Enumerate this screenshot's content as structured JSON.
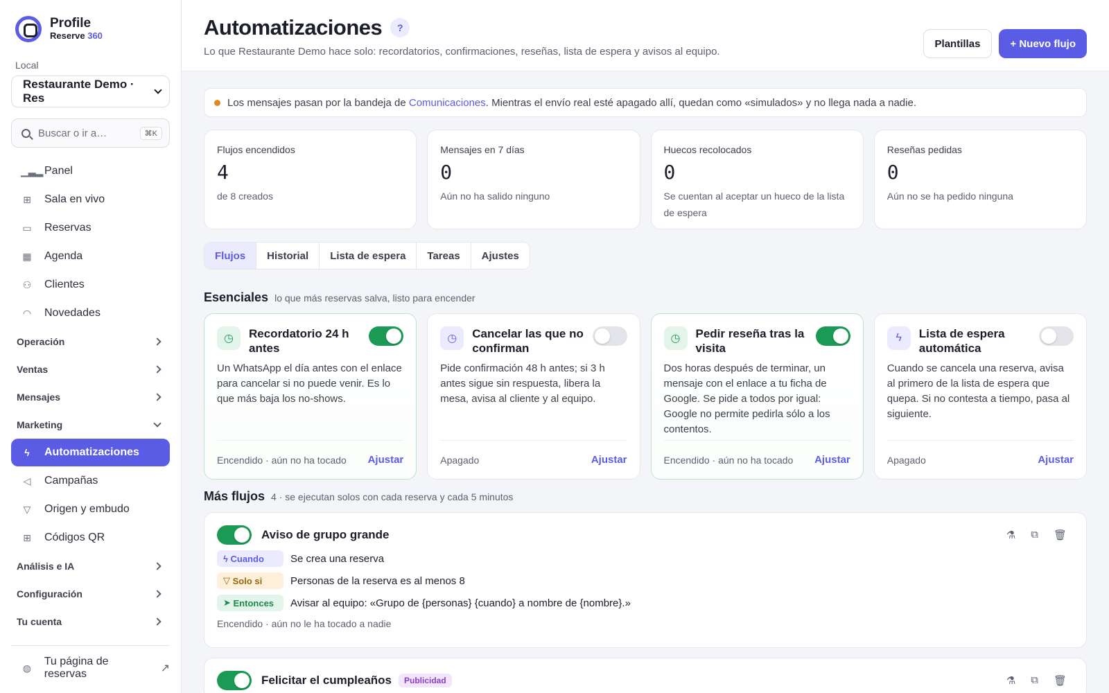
{
  "brand": {
    "name": "Profile",
    "sub_main": "Reserve ",
    "sub_num": "360"
  },
  "sidebar": {
    "local_label": "Local",
    "local_value": "Restaurante Demo · Res",
    "search_placeholder": "Buscar o ir a…",
    "search_kbd": "⌘K",
    "items": [
      {
        "label": "Panel",
        "icon": "chart-icon"
      },
      {
        "label": "Sala en vivo",
        "icon": "grid-icon"
      },
      {
        "label": "Reservas",
        "icon": "calendar-icon"
      },
      {
        "label": "Agenda",
        "icon": "table-icon"
      },
      {
        "label": "Clientes",
        "icon": "users-icon"
      },
      {
        "label": "Novedades",
        "icon": "bell-icon"
      }
    ],
    "groups": {
      "operacion": "Operación",
      "ventas": "Ventas",
      "mensajes": "Mensajes",
      "marketing": "Marketing",
      "analisis": "Análisis e IA",
      "configuracion": "Configuración",
      "cuenta": "Tu cuenta"
    },
    "marketing_items": [
      {
        "label": "Automatizaciones",
        "active": true
      },
      {
        "label": "Campañas"
      },
      {
        "label": "Origen y embudo"
      },
      {
        "label": "Códigos QR"
      }
    ],
    "booking_page": "Tu página de reservas"
  },
  "header": {
    "title": "Automatizaciones",
    "help": "?",
    "subtitle": "Lo que Restaurante Demo hace solo: recordatorios, confirmaciones, reseñas, lista de espera y avisos al equipo.",
    "templates_button": "Plantillas",
    "new_flow_button": "+ Nuevo flujo"
  },
  "notice": {
    "before": "Los mensajes pasan por la bandeja de ",
    "link": "Comunicaciones",
    "after": ". Mientras el envío real esté apagado allí, quedan como «simulados» y no llega nada a nadie."
  },
  "stats": [
    {
      "label": "Flujos encendidos",
      "value": "4",
      "note": "de 8 creados"
    },
    {
      "label": "Mensajes en 7 días",
      "value": "0",
      "note": "Aún no ha salido ninguno"
    },
    {
      "label": "Huecos recolocados",
      "value": "0",
      "note": "Se cuentan al aceptar un hueco de la lista de espera"
    },
    {
      "label": "Reseñas pedidas",
      "value": "0",
      "note": "Aún no se ha pedido ninguna"
    }
  ],
  "tabs": [
    "Flujos",
    "Historial",
    "Lista de espera",
    "Tareas",
    "Ajustes"
  ],
  "essentials": {
    "title": "Esenciales",
    "subtitle": "lo que más reservas salva, listo para encender",
    "adjust_label": "Ajustar",
    "cards": [
      {
        "title": "Recordatorio 24 h antes",
        "on": true,
        "desc": "Un WhatsApp el día antes con el enlace para cancelar si no puede venir. Es lo que más baja los no-shows.",
        "status": "Encendido · aún no ha tocado"
      },
      {
        "title": "Cancelar las que no confirman",
        "on": false,
        "desc": "Pide confirmación 48 h antes; si 3 h antes sigue sin respuesta, libera la mesa, avisa al cliente y al equipo.",
        "status": "Apagado"
      },
      {
        "title": "Pedir reseña tras la visita",
        "on": true,
        "desc": "Dos horas después de terminar, un mensaje con el enlace a tu ficha de Google. Se pide a todos por igual: Google no permite pedirla sólo a los contentos.",
        "status": "Encendido · aún no ha tocado"
      },
      {
        "title": "Lista de espera automática",
        "on": false,
        "desc": "Cuando se cancela una reserva, avisa al primero de la lista de espera que quepa. Si no contesta a tiempo, pasa al siguiente.",
        "status": "Apagado"
      }
    ]
  },
  "more_flows": {
    "title": "Más flujos",
    "subtitle": "4 · se ejecutan solos con cada reserva y cada 5 minutos",
    "flow1": {
      "title": "Aviso de grupo grande",
      "when_chip": "Cuando",
      "when_text": "Se crea una reserva",
      "if_chip": "Solo si",
      "if_text": "Personas de la reserva es al menos 8",
      "then_chip": "Entonces",
      "then_text": "Avisar al equipo: «Grupo de {personas} {cuando} a nombre de {nombre}.»",
      "status": "Encendido · aún no le ha tocado a nadie"
    },
    "flow2": {
      "title": "Felicitar el cumpleaños",
      "badge": "Publicidad"
    }
  },
  "colors": {
    "accent": "#5b5ce6",
    "on": "#1a9a55",
    "warning": "#e08a1e"
  }
}
